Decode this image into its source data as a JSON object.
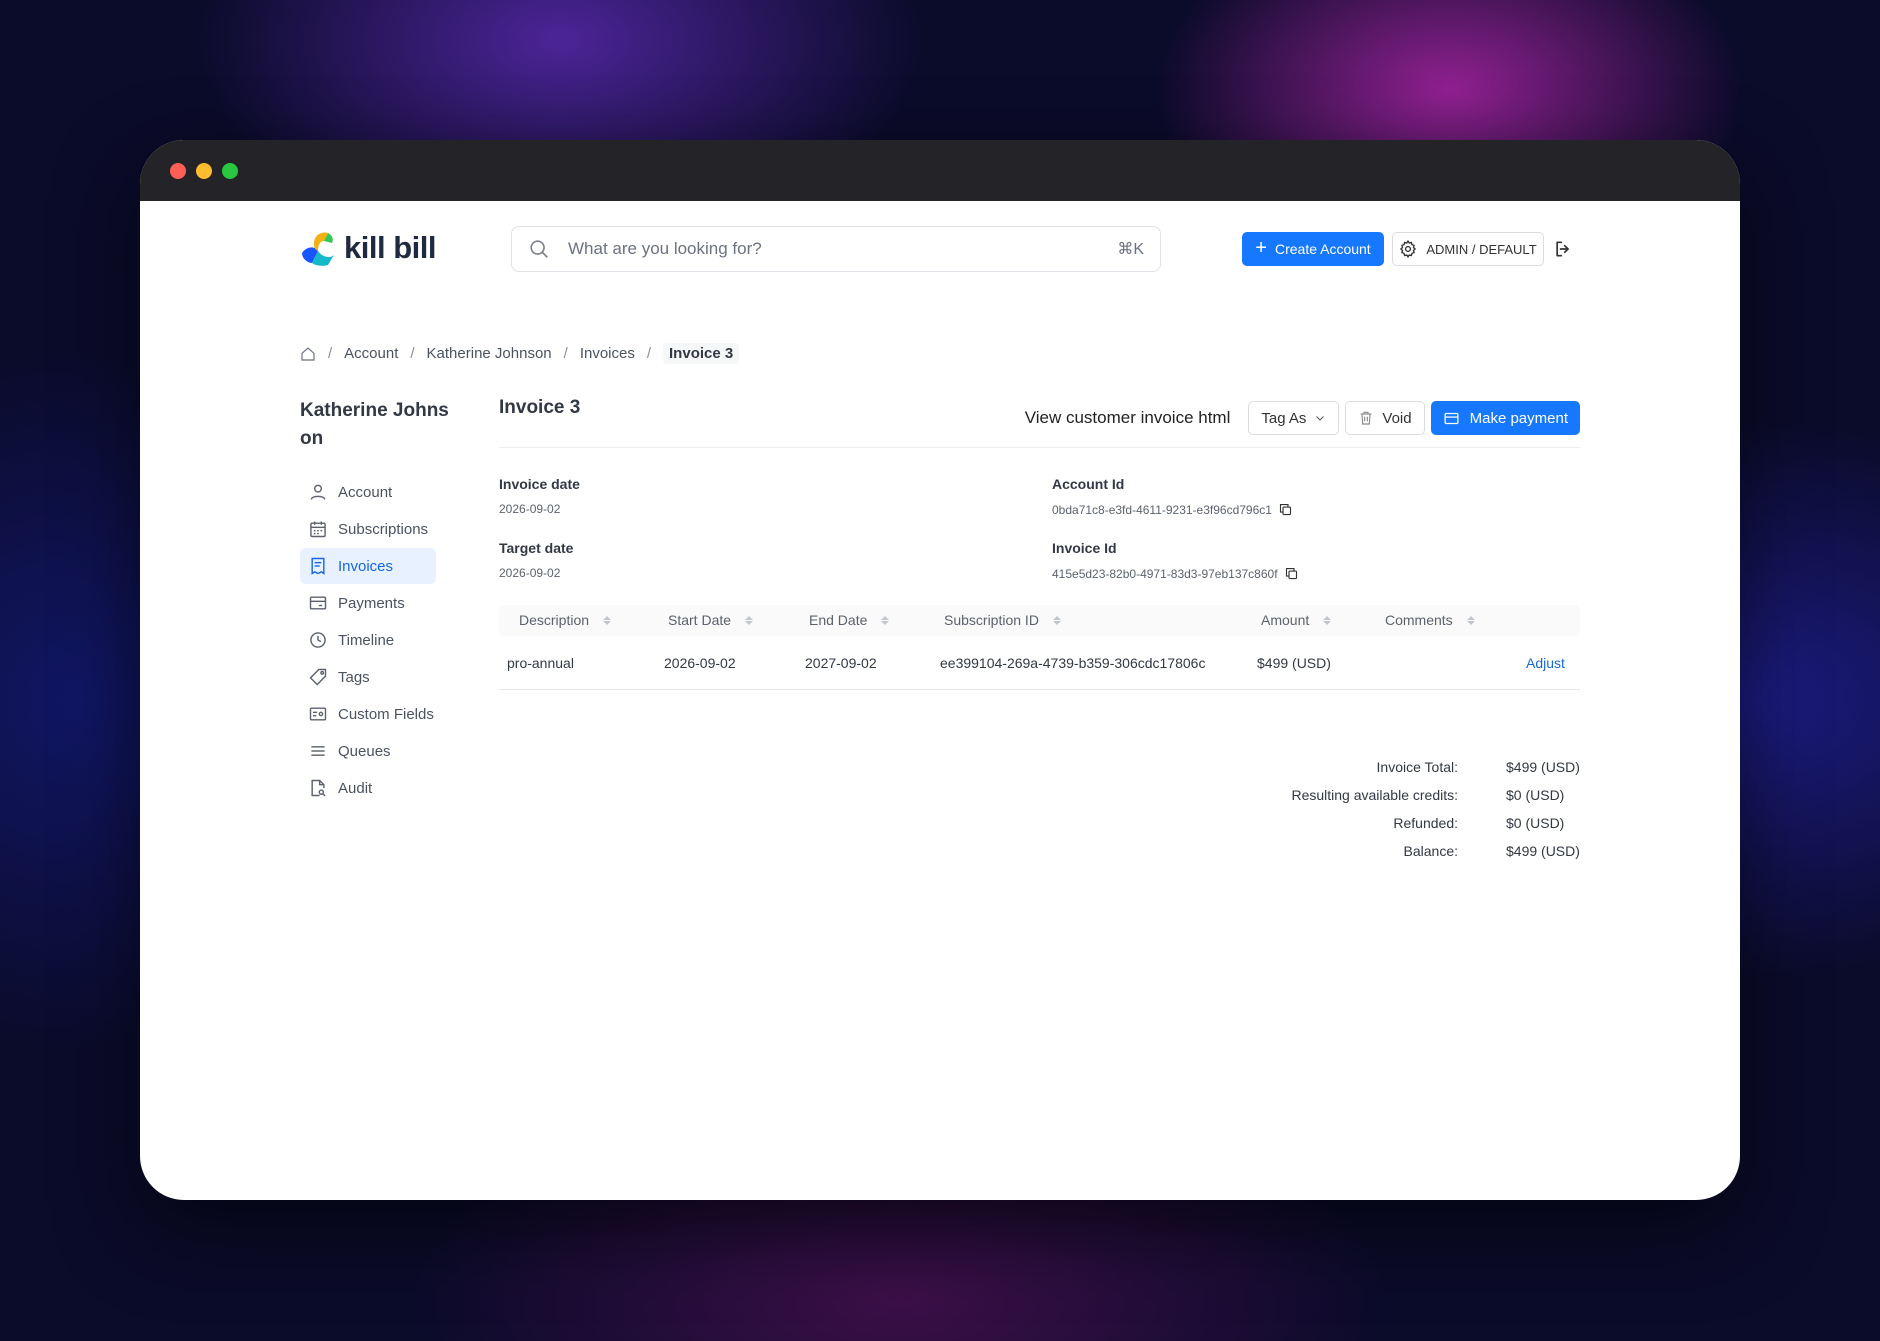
{
  "header": {
    "logo_text": "kill bill",
    "search_placeholder": "What are you looking for?",
    "search_shortcut": "⌘K",
    "create_account_label": "Create Account",
    "admin_label": "ADMIN / DEFAULT"
  },
  "breadcrumb": {
    "items": [
      "Account",
      "Katherine Johnson",
      "Invoices"
    ],
    "current": "Invoice 3"
  },
  "sidebar": {
    "customer_name": "Katherine Johnson",
    "items": [
      {
        "label": "Account",
        "icon": "user-icon"
      },
      {
        "label": "Subscriptions",
        "icon": "calendar-icon"
      },
      {
        "label": "Invoices",
        "icon": "receipt-icon",
        "active": true
      },
      {
        "label": "Payments",
        "icon": "credit-card-icon"
      },
      {
        "label": "Timeline",
        "icon": "clock-icon"
      },
      {
        "label": "Tags",
        "icon": "tag-icon"
      },
      {
        "label": "Custom Fields",
        "icon": "id-card-icon"
      },
      {
        "label": "Queues",
        "icon": "list-icon"
      },
      {
        "label": "Audit",
        "icon": "file-search-icon"
      }
    ]
  },
  "invoice": {
    "title": "Invoice 3",
    "view_html_label": "View customer invoice html",
    "tag_as_label": "Tag As",
    "void_label": "Void",
    "make_payment_label": "Make payment",
    "invoice_date_label": "Invoice date",
    "invoice_date": "2026-09-02",
    "target_date_label": "Target date",
    "target_date": "2026-09-02",
    "account_id_label": "Account Id",
    "account_id": "0bda71c8-e3fd-4611-9231-e3f96cd796c1",
    "invoice_id_label": "Invoice Id",
    "invoice_id": "415e5d23-82b0-4971-83d3-97eb137c860f"
  },
  "table": {
    "columns": [
      "Description",
      "Start Date",
      "End Date",
      "Subscription ID",
      "Amount",
      "Comments"
    ],
    "rows": [
      {
        "description": "pro-annual",
        "start_date": "2026-09-02",
        "end_date": "2027-09-02",
        "subscription_id": "ee399104-269a-4739-b359-306cdc17806c",
        "amount": "$499 (USD)",
        "comments": "",
        "action": "Adjust"
      }
    ]
  },
  "totals": [
    {
      "label": "Invoice Total:",
      "value": "$499 (USD)"
    },
    {
      "label": "Resulting available credits:",
      "value": "$0 (USD)"
    },
    {
      "label": "Refunded:",
      "value": "$0 (USD)"
    },
    {
      "label": "Balance:",
      "value": "$499 (USD)"
    }
  ],
  "colors": {
    "primary": "#1677ff",
    "active_bg": "#e8f1ff",
    "titlebar": "#242428"
  }
}
